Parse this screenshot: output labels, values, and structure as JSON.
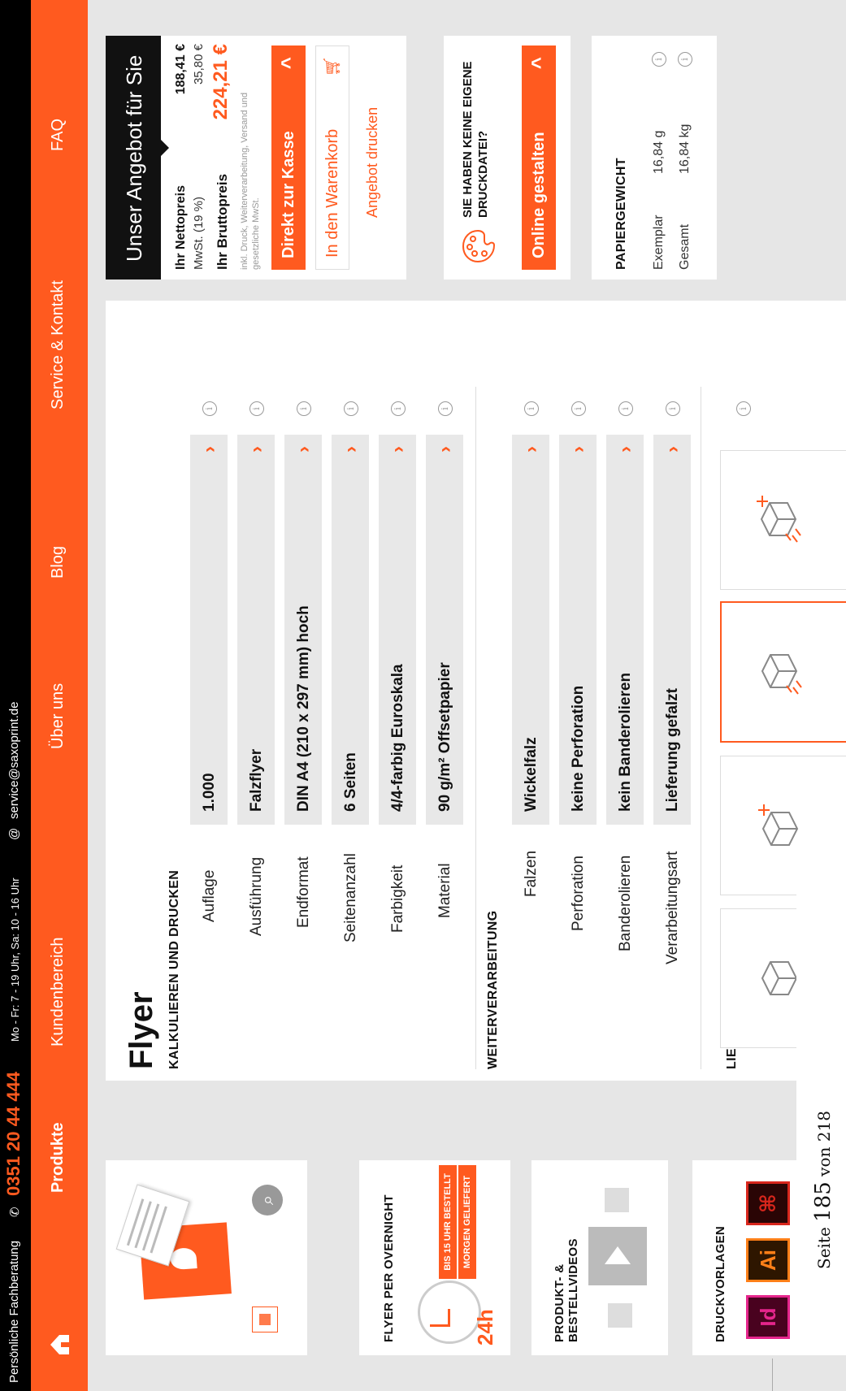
{
  "topbar": {
    "consult_label": "Persönliche Fachberatung",
    "phone": "0351 20 44 444",
    "hours": "Mo - Fr: 7 - 19 Uhr, Sa: 10 - 16 Uhr",
    "email": "service@saxoprint.de"
  },
  "nav": {
    "items": [
      "Produkte",
      "Kundenbereich",
      "Über uns",
      "Blog",
      "Service & Kontakt",
      "FAQ"
    ]
  },
  "product": {
    "title": "Flyer",
    "section_calc": "KALKULIEREN UND DRUCKEN",
    "section_finish": "WEITERVERARBEITUNG",
    "section_delivery": "LIEFERUNG",
    "calc_rows": [
      {
        "label": "Auflage",
        "value": "1.000"
      },
      {
        "label": "Ausführung",
        "value": "Falzflyer"
      },
      {
        "label": "Endformat",
        "value": "DIN A4 (210 x 297 mm) hoch"
      },
      {
        "label": "Seitenanzahl",
        "value": "6 Seiten"
      },
      {
        "label": "Farbigkeit",
        "value": "4/4-farbig Euroskala"
      },
      {
        "label": "Material",
        "value": "90 g/m² Offsetpapier"
      }
    ],
    "finish_rows": [
      {
        "label": "Falzen",
        "value": "Wickelfalz"
      },
      {
        "label": "Perforation",
        "value": "keine Perforation"
      },
      {
        "label": "Banderolieren",
        "value": "kein Banderolieren"
      },
      {
        "label": "Verarbeitungsart",
        "value": "Lieferung gefalzt"
      }
    ]
  },
  "offer": {
    "title": "Unser Angebot für Sie",
    "net_label": "Ihr Nettopreis",
    "net_value": "188,41 €",
    "vat_label": "MwSt. (19 %)",
    "vat_value": "35,80 €",
    "gross_label": "Ihr Bruttopreis",
    "gross_value": "224,21 €",
    "note": "inkl. Druck, Weiterverarbeitung, Versand und gesetzliche MwSt.",
    "checkout_label": "Direkt zur Kasse",
    "cart_label": "In den Warenkorb",
    "print_offer_label": "Angebot drucken"
  },
  "online": {
    "question": "SIE HABEN KEINE EIGENE DRUCKDATEI?",
    "button_label": "Online gestalten"
  },
  "weight": {
    "title": "PAPIERGEWICHT",
    "item_label": "Exemplar",
    "item_value": "16,84 g",
    "total_label": "Gesamt",
    "total_value": "16,84 kg"
  },
  "left_cards": {
    "overnight_title": "FLYER PER OVERNIGHT",
    "overnight_badge_1": "BIS 15 UHR BESTELLT",
    "overnight_badge_2": "MORGEN GELIEFERT",
    "overnight_clock": "24h",
    "videos_title": "PRODUKT- & BESTELLVIDEOS",
    "templates_title": "DRUCKVORLAGEN",
    "template_icons": [
      "Id",
      "Ai"
    ]
  },
  "footer": {
    "page_prefix": "Seite",
    "page_number": "185",
    "page_mid": "von",
    "page_total": "218"
  },
  "colors": {
    "accent": "#ff5a1f",
    "topbar": "#000000",
    "indesign": "#e5258c",
    "illustrator": "#ff7f18",
    "acrobat": "#d8261c"
  }
}
